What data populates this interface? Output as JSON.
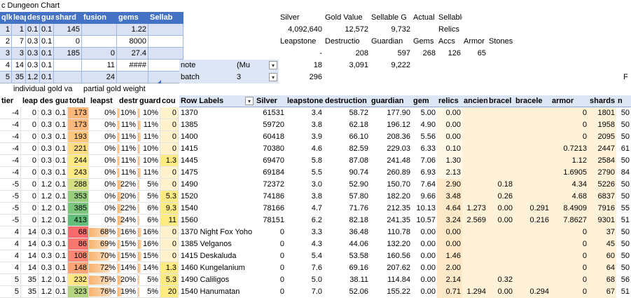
{
  "sheet_title": "c Dungeon Chart",
  "left_table": {
    "headers": [
      "qlkp",
      "leap",
      "dest",
      "guar",
      "shard",
      "fusion",
      "gems",
      "Sellab"
    ],
    "rows": [
      [
        "1",
        "1",
        "0.1",
        "0.1",
        "145",
        "",
        "1.22",
        ""
      ],
      [
        "2",
        "7",
        "0.3",
        "0.1",
        "0",
        "",
        "8000",
        ""
      ],
      [
        "3",
        "3",
        "0.3",
        "0.1",
        "185",
        "0",
        "27.4",
        ""
      ],
      [
        "4",
        "14",
        "0.3",
        "0.1",
        "",
        "11",
        "####",
        ""
      ],
      [
        "5",
        "35",
        "1.2",
        "0.1",
        "",
        "24",
        "",
        ""
      ]
    ]
  },
  "summary": {
    "row1": [
      "Silver",
      "Gold Value",
      "Sellable G",
      "Actual",
      "Sellable"
    ],
    "row2": [
      "4,092,640",
      "12,572",
      "9,732",
      "",
      "Relics"
    ],
    "row3": [
      "Leapstone",
      "Destructio",
      "Guardian",
      "Gems",
      "Accs",
      "Armor",
      "Stones"
    ],
    "row4": [
      "-",
      "208",
      "597",
      "268",
      "126",
      "65"
    ]
  },
  "filters": {
    "note_label": "note",
    "note_value": "(Mu",
    "batch_label": "batch",
    "batch_value": "3",
    "note_nums": [
      "18",
      "3,091",
      "9,222"
    ],
    "batch_num": "296"
  },
  "section_labels": {
    "left": "individual gold va",
    "mid": "partial gold weight",
    "right_edge": "F"
  },
  "main_headers": [
    "tier",
    "leap",
    "des",
    "gua",
    "total",
    "leapst",
    "destr",
    "guard",
    "cou"
  ],
  "pivot_headers": [
    "Row Labels",
    "Silver",
    "leapstones",
    "destruction",
    "guardian",
    "gem",
    "relics",
    "ancien",
    "bracel",
    "bracele",
    "armor",
    "shards",
    "n"
  ],
  "main_rows": [
    [
      "-4",
      "0",
      "0.3",
      "0.1",
      "173",
      "0%",
      "10%",
      "10%",
      "0"
    ],
    [
      "-4",
      "0",
      "0.3",
      "0.1",
      "173",
      "0%",
      "11%",
      "11%",
      "0"
    ],
    [
      "-4",
      "0",
      "0.3",
      "0.1",
      "193",
      "0%",
      "11%",
      "11%",
      "0"
    ],
    [
      "-4",
      "0",
      "0.3",
      "0.1",
      "221",
      "0%",
      "11%",
      "10%",
      "0"
    ],
    [
      "-4",
      "0",
      "0.3",
      "0.1",
      "244",
      "0%",
      "11%",
      "10%",
      "1.3"
    ],
    [
      "-4",
      "0",
      "0.3",
      "0.1",
      "243",
      "0%",
      "11%",
      "11%",
      "0"
    ],
    [
      "-5",
      "0",
      "1.2",
      "0.1",
      "288",
      "0%",
      "22%",
      "5%",
      "0"
    ],
    [
      "-5",
      "0",
      "1.2",
      "0.1",
      "353",
      "0%",
      "20%",
      "5%",
      "5.3"
    ],
    [
      "-5",
      "0",
      "1.2",
      "0.1",
      "385",
      "0%",
      "22%",
      "6%",
      "9.3"
    ],
    [
      "-5",
      "0",
      "1.2",
      "0.1",
      "413",
      "0%",
      "24%",
      "6%",
      "11"
    ],
    [
      "4",
      "14",
      "0.3",
      "0.1",
      "68",
      "68%",
      "16%",
      "16%",
      "0"
    ],
    [
      "4",
      "14",
      "0.3",
      "0.1",
      "86",
      "69%",
      "15%",
      "16%",
      "0"
    ],
    [
      "4",
      "14",
      "0.3",
      "0.1",
      "108",
      "70%",
      "15%",
      "15%",
      "0"
    ],
    [
      "4",
      "14",
      "0.3",
      "0.1",
      "148",
      "72%",
      "14%",
      "14%",
      "1.3"
    ],
    [
      "5",
      "35",
      "1.2",
      "0.1",
      "232",
      "75%",
      "20%",
      "5%",
      "5.3"
    ],
    [
      "5",
      "35",
      "1.2",
      "0.1",
      "323",
      "76%",
      "19%",
      "5%",
      "20"
    ]
  ],
  "pivot_rows": [
    [
      "1370",
      "61531",
      "3.4",
      "58.72",
      "177.90",
      "5.00",
      "0.00",
      "",
      "",
      "",
      "0",
      "1801",
      "50"
    ],
    [
      "1385",
      "59720",
      "3.8",
      "62.18",
      "196.12",
      "4.90",
      "0.00",
      "",
      "",
      "",
      "0",
      "1958",
      "50"
    ],
    [
      "1400",
      "60418",
      "3.9",
      "66.10",
      "208.36",
      "5.56",
      "0.00",
      "",
      "",
      "",
      "0",
      "2095",
      "50"
    ],
    [
      "1415",
      "70380",
      "4.6",
      "82.59",
      "229.03",
      "6.33",
      "0.10",
      "",
      "",
      "",
      "0.7213",
      "2447",
      "61"
    ],
    [
      "1445",
      "69470",
      "5.8",
      "87.08",
      "241.48",
      "7.06",
      "1.30",
      "",
      "",
      "",
      "1.12",
      "2584",
      "50"
    ],
    [
      "1475",
      "69184",
      "5.5",
      "90.74",
      "260.89",
      "6.93",
      "2.13",
      "",
      "",
      "",
      "1.6905",
      "2790",
      "84"
    ],
    [
      "1490",
      "72372",
      "3.0",
      "52.90",
      "150.70",
      "7.64",
      "2.90",
      "",
      "0.18",
      "",
      "4.34",
      "5226",
      "50"
    ],
    [
      "1520",
      "74186",
      "3.8",
      "57.80",
      "182.20",
      "9.66",
      "3.48",
      "",
      "0.26",
      "",
      "4.68",
      "6837",
      "50"
    ],
    [
      "1540",
      "78166",
      "4.7",
      "71.76",
      "212.35",
      "10.13",
      "4.64",
      "1.273",
      "0.00",
      "0.291",
      "8.4909",
      "7916",
      "55"
    ],
    [
      "1560",
      "78151",
      "6.2",
      "82.18",
      "241.35",
      "10.57",
      "3.24",
      "2.569",
      "0.00",
      "0.216",
      "7.8627",
      "9301",
      "51"
    ],
    [
      "1370 Night Fox Yoho",
      "0",
      "3.3",
      "36.48",
      "110.78",
      "0.00",
      "0.00",
      "",
      "",
      "",
      "0",
      "37",
      "50"
    ],
    [
      "1385 Velganos",
      "0",
      "4.3",
      "44.06",
      "132.20",
      "0.00",
      "0.00",
      "",
      "",
      "",
      "0",
      "45",
      "50"
    ],
    [
      "1415 Deskaluda",
      "0",
      "5.4",
      "53.58",
      "160.56",
      "0.00",
      "1.46",
      "",
      "",
      "",
      "0",
      "60",
      "50"
    ],
    [
      "1460 Kungelanium",
      "0",
      "7.6",
      "69.16",
      "207.62",
      "0.00",
      "2.00",
      "",
      "",
      "",
      "0",
      "64",
      "50"
    ],
    [
      "1490 Caliligos",
      "0",
      "5.0",
      "38.11",
      "114.84",
      "0.00",
      "2.14",
      "",
      "0.32",
      "",
      "0",
      "68",
      "56"
    ],
    [
      "1540 Hanumatan",
      "0",
      "7.0",
      "52.06",
      "155.22",
      "0.00",
      "0.71",
      "1.294",
      "0.00",
      "0.294",
      "0",
      "67",
      "51"
    ]
  ],
  "colors": {
    "table_header": "#4472c4",
    "band": "#d9e1f2",
    "pivot_header": "#dce6f4",
    "bar_color": "#63be7b"
  }
}
